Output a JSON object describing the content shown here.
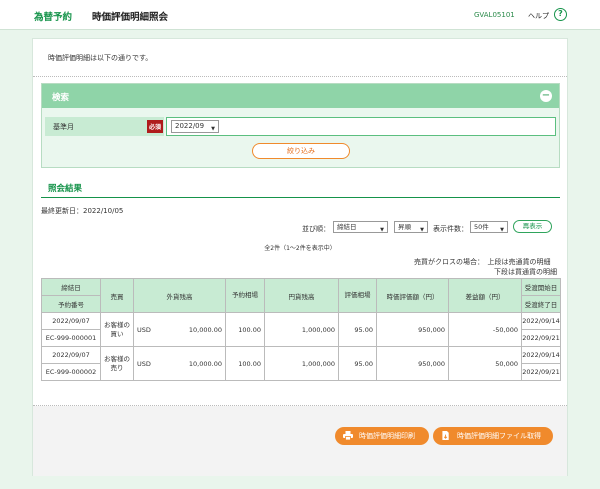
{
  "header": {
    "brand": "為替予約",
    "page_title": "時価評価明細照会",
    "screen_code": "GVAL05101",
    "help_label": "ヘルプ",
    "help_icon": "question-circle-icon"
  },
  "intro_text": "時価評価明細は以下の通りです。",
  "search": {
    "title": "検索",
    "collapse_symbol": "−",
    "field_label": "基準月",
    "required_label": "必須",
    "month_value": "2022/09",
    "narrow_button": "絞り込み"
  },
  "results": {
    "title": "照会結果",
    "last_updated": "最終更新日：2022/10/05",
    "sort_label": "並び順：",
    "sort_key": "締結日",
    "sort_order": "昇順",
    "display_label": "表示件数：",
    "display_count": "50件",
    "redisplay_button": "再表示",
    "count_text": "全2件（1～2件を表示中）",
    "note_line1": "売買がクロスの場合：　上段は売通貨の明細",
    "note_line2": "下段は買通貨の明細",
    "columns": {
      "contract_date": "締結日",
      "reservation_no": "予約番号",
      "buy_sell": "売買",
      "fx_balance": "外貨残高",
      "reservation_rate": "予約相場",
      "yen_balance": "円貨残高",
      "valuation_rate": "評価相場",
      "valuation_amount": "時価評価額（円）",
      "difference": "差益額（円）",
      "delivery_start": "受渡開始日",
      "delivery_end": "受渡終了日"
    },
    "rows": [
      {
        "contract_date": "2022/09/07",
        "reservation_no": "EC-999-000001",
        "buy_sell": "お客様の買い",
        "currency": "USD",
        "fx_balance": "10,000.00",
        "reservation_rate": "100.00",
        "yen_balance": "1,000,000",
        "valuation_rate": "95.00",
        "valuation_amount": "950,000",
        "difference": "-50,000",
        "delivery_start": "2022/09/14",
        "delivery_end": "2022/09/21"
      },
      {
        "contract_date": "2022/09/07",
        "reservation_no": "EC-999-000002",
        "buy_sell": "お客様の売り",
        "currency": "USD",
        "fx_balance": "10,000.00",
        "reservation_rate": "100.00",
        "yen_balance": "1,000,000",
        "valuation_rate": "95.00",
        "valuation_amount": "950,000",
        "difference": "50,000",
        "delivery_start": "2022/09/14",
        "delivery_end": "2022/09/21"
      }
    ]
  },
  "footer": {
    "print_button": "時価評価明細印刷",
    "print_icon": "printer-icon",
    "download_button": "時価評価明細ファイル取得",
    "download_icon": "file-download-icon"
  },
  "colors": {
    "brand_green": "#15934a",
    "header_green": "#8fd4a8",
    "light_green": "#c8ebd3",
    "orange": "#f08a2c",
    "required_red": "#b01c1c"
  }
}
